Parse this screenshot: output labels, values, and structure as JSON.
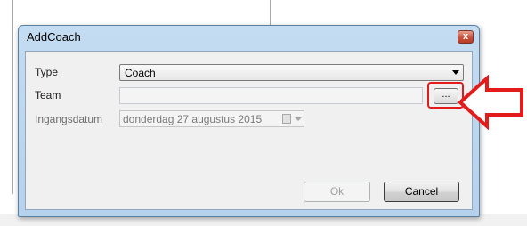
{
  "dialog": {
    "title": "AddCoach",
    "close_label": "x",
    "type": {
      "label": "Type",
      "selected": "Coach"
    },
    "team": {
      "label": "Team",
      "value": "",
      "browse_label": "..."
    },
    "ingangsdatum": {
      "label": "Ingangsdatum",
      "value": "donderdag 27  augustus  2015"
    },
    "buttons": {
      "ok_label": "Ok",
      "cancel_label": "Cancel"
    }
  },
  "annotation": {
    "color": "#e31b1b",
    "icon": "left-arrow-outline"
  },
  "colors": {
    "titlebar": "#b9d4ee",
    "highlight": "#e31b1b",
    "client_bg": "#f0f0f0"
  }
}
